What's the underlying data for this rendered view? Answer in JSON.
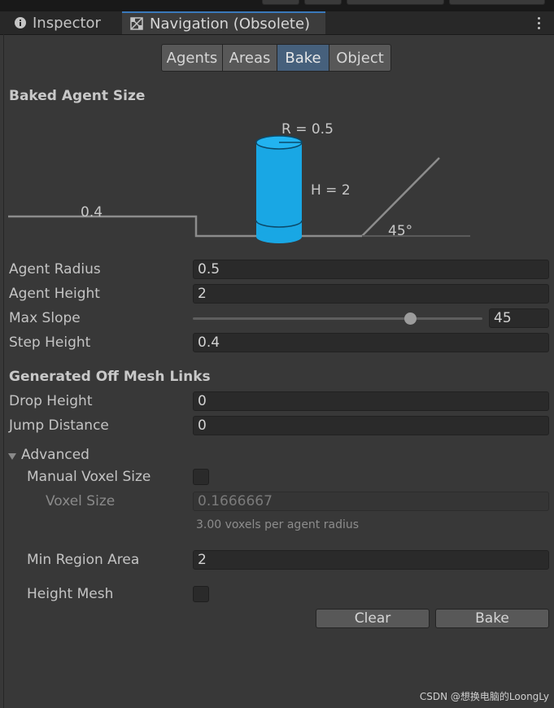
{
  "tabs": {
    "inspector": "Inspector",
    "navigation": "Navigation (Obsolete)"
  },
  "segments": [
    "Agents",
    "Areas",
    "Bake",
    "Object"
  ],
  "active_segment": "Bake",
  "baked_agent_size": {
    "heading": "Baked Agent Size",
    "radius_label": "R = 0.5",
    "height_label": "H = 2",
    "step_label": "0.4",
    "slope_label": "45°"
  },
  "fields": {
    "agent_radius": {
      "label": "Agent Radius",
      "value": "0.5"
    },
    "agent_height": {
      "label": "Agent Height",
      "value": "2"
    },
    "max_slope": {
      "label": "Max Slope",
      "value": "45",
      "slider_fraction": 0.75
    },
    "step_height": {
      "label": "Step Height",
      "value": "0.4"
    }
  },
  "offmesh": {
    "heading": "Generated Off Mesh Links",
    "drop_height": {
      "label": "Drop Height",
      "value": "0"
    },
    "jump_distance": {
      "label": "Jump Distance",
      "value": "0"
    }
  },
  "advanced": {
    "label": "Advanced",
    "manual_voxel_size": {
      "label": "Manual Voxel Size",
      "checked": false
    },
    "voxel_size": {
      "label": "Voxel Size",
      "value": "0.1666667"
    },
    "hint": "3.00 voxels per agent radius",
    "min_region_area": {
      "label": "Min Region Area",
      "value": "2"
    },
    "height_mesh": {
      "label": "Height Mesh",
      "checked": false
    }
  },
  "buttons": {
    "clear": "Clear",
    "bake": "Bake"
  },
  "watermark": "CSDN @想换电脑的LoongLy",
  "colors": {
    "accent": "#3a79bb",
    "active_segment": "#46607c",
    "agent_cylinder": "#19a7e4"
  }
}
